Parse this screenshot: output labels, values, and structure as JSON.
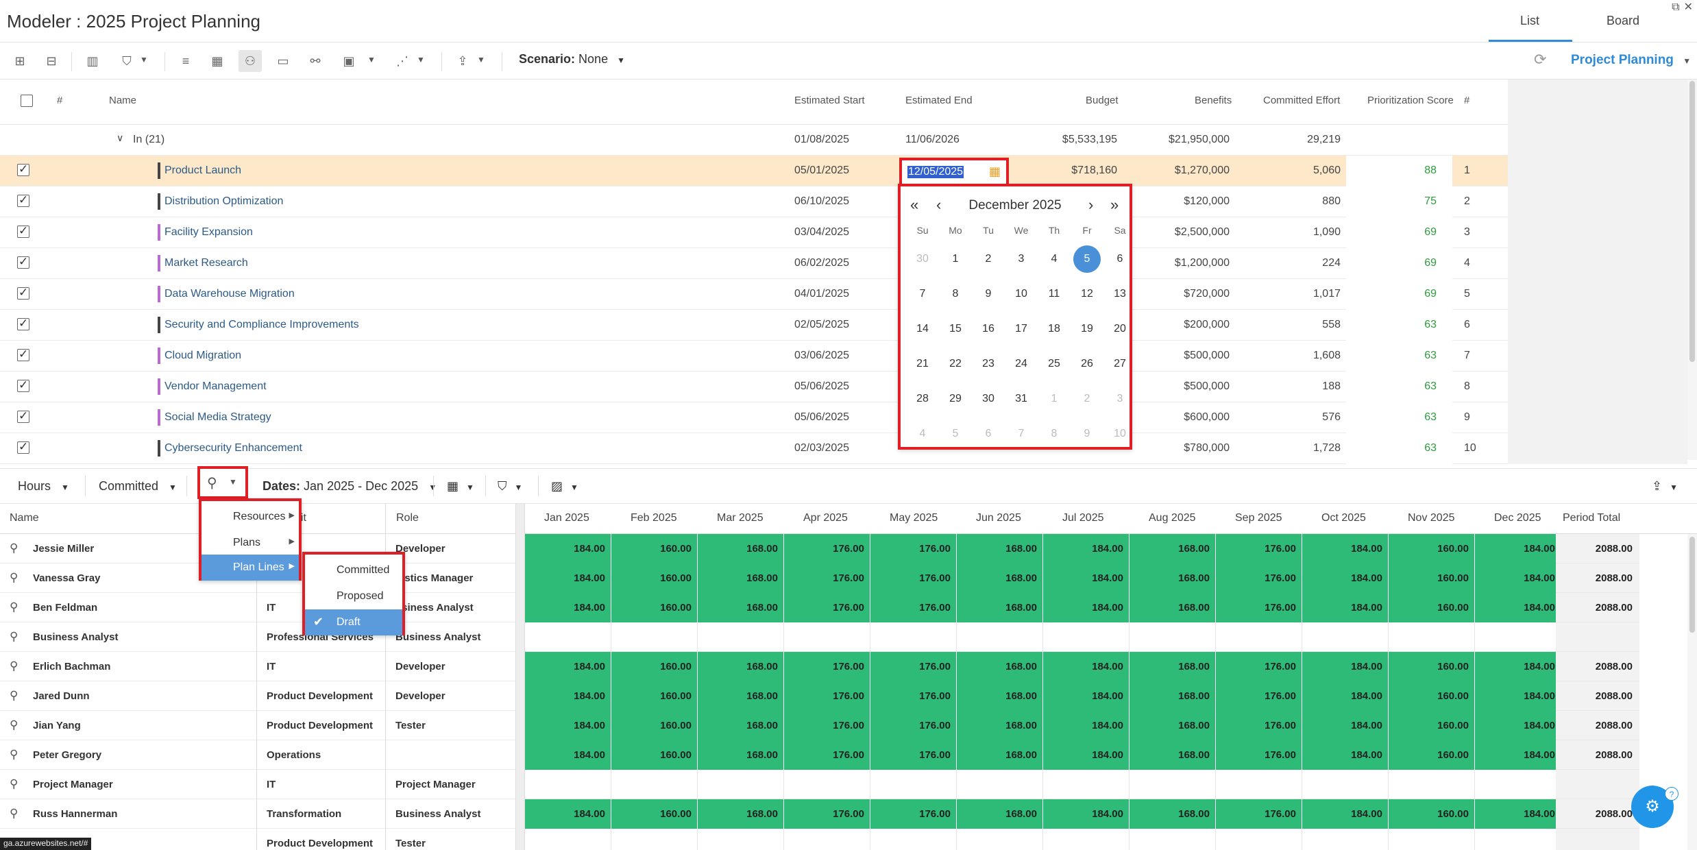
{
  "app": {
    "title": "Modeler : 2025 Project Planning",
    "tabs": [
      "List",
      "Board"
    ],
    "active_tab": "List"
  },
  "toolbar": {
    "scenario_label": "Scenario:",
    "scenario_value": "None",
    "project_selector": "Project Planning"
  },
  "grid": {
    "headers": {
      "num": "#",
      "name": "Name",
      "est_start": "Estimated Start",
      "est_end": "Estimated End",
      "budget": "Budget",
      "benefits": "Benefits",
      "effort": "Committed Effort",
      "score": "Prioritization Score",
      "rank": "#"
    },
    "group": {
      "label": "In (21)",
      "est_start": "01/08/2025",
      "est_end": "11/06/2026",
      "budget": "$5,533,195",
      "benefits": "$21,950,000",
      "effort": "29,219"
    },
    "rows": [
      {
        "name": "Product Launch",
        "est_start": "05/01/2025",
        "est_end": "12/05/2025",
        "budget": "$718,160",
        "benefits": "$1,270,000",
        "effort": "5,060",
        "score": "88",
        "rank": "1",
        "color": "#444444"
      },
      {
        "name": "Distribution Optimization",
        "est_start": "06/10/2025",
        "est_end": "",
        "budget": "",
        "benefits": "$120,000",
        "effort": "880",
        "score": "75",
        "rank": "2",
        "color": "#444444"
      },
      {
        "name": "Facility Expansion",
        "est_start": "03/04/2025",
        "est_end": "",
        "budget": "",
        "benefits": "$2,500,000",
        "effort": "1,090",
        "score": "69",
        "rank": "3",
        "color": "#b86bd0"
      },
      {
        "name": "Market Research",
        "est_start": "06/02/2025",
        "est_end": "",
        "budget": "",
        "benefits": "$1,200,000",
        "effort": "224",
        "score": "69",
        "rank": "4",
        "color": "#b86bd0"
      },
      {
        "name": "Data Warehouse Migration",
        "est_start": "04/01/2025",
        "est_end": "",
        "budget": "",
        "benefits": "$720,000",
        "effort": "1,017",
        "score": "69",
        "rank": "5",
        "color": "#b86bd0"
      },
      {
        "name": "Security and Compliance Improvements",
        "est_start": "02/05/2025",
        "est_end": "",
        "budget": "",
        "benefits": "$200,000",
        "effort": "558",
        "score": "63",
        "rank": "6",
        "color": "#444444"
      },
      {
        "name": "Cloud Migration",
        "est_start": "03/06/2025",
        "est_end": "",
        "budget": "",
        "benefits": "$500,000",
        "effort": "1,608",
        "score": "63",
        "rank": "7",
        "color": "#b86bd0"
      },
      {
        "name": "Vendor Management",
        "est_start": "05/06/2025",
        "est_end": "",
        "budget": "",
        "benefits": "$500,000",
        "effort": "188",
        "score": "63",
        "rank": "8",
        "color": "#b86bd0"
      },
      {
        "name": "Social Media Strategy",
        "est_start": "05/06/2025",
        "est_end": "",
        "budget": "",
        "benefits": "$600,000",
        "effort": "576",
        "score": "63",
        "rank": "9",
        "color": "#b86bd0"
      },
      {
        "name": "Cybersecurity Enhancement",
        "est_start": "02/03/2025",
        "est_end": "",
        "budget": "",
        "benefits": "$780,000",
        "effort": "1,728",
        "score": "63",
        "rank": "10",
        "color": "#444444"
      }
    ]
  },
  "date_editor": {
    "value": "12/05/2025"
  },
  "calendar": {
    "title": "December 2025",
    "nav": {
      "prev_year": "«",
      "prev": "‹",
      "next": "›",
      "next_year": "»"
    },
    "dow": [
      "Su",
      "Mo",
      "Tu",
      "We",
      "Th",
      "Fr",
      "Sa"
    ],
    "weeks": [
      [
        "30",
        "1",
        "2",
        "3",
        "4",
        "5",
        "6"
      ],
      [
        "7",
        "8",
        "9",
        "10",
        "11",
        "12",
        "13"
      ],
      [
        "14",
        "15",
        "16",
        "17",
        "18",
        "19",
        "20"
      ],
      [
        "21",
        "22",
        "23",
        "24",
        "25",
        "26",
        "27"
      ],
      [
        "28",
        "29",
        "30",
        "31",
        "1",
        "2",
        "3"
      ],
      [
        "4",
        "5",
        "6",
        "7",
        "8",
        "9",
        "10"
      ]
    ],
    "selected": "5"
  },
  "lower_toolbar": {
    "units": "Hours",
    "mode": "Committed",
    "dates_label": "Dates:",
    "dates_value": "Jan 2025 - Dec 2025"
  },
  "resource_grid": {
    "headers": {
      "name": "Name",
      "unit": "s Unit",
      "role": "Role",
      "months": [
        "Jan 2025",
        "Feb 2025",
        "Mar 2025",
        "Apr 2025",
        "May 2025",
        "Jun 2025",
        "Jul 2025",
        "Aug 2025",
        "Sep 2025",
        "Oct 2025",
        "Nov 2025",
        "Dec 2025"
      ],
      "total": "Period Total"
    },
    "std_values": [
      "184.00",
      "160.00",
      "168.00",
      "176.00",
      "176.00",
      "168.00",
      "184.00",
      "168.00",
      "176.00",
      "184.00",
      "160.00",
      "184.00"
    ],
    "rows": [
      {
        "name": "Jessie Miller",
        "unit": "tions",
        "role": "Developer",
        "filled": true,
        "total": "2088.00"
      },
      {
        "name": "Vanessa Gray",
        "unit": "",
        "role": "gistics Manager",
        "filled": true,
        "total": "2088.00"
      },
      {
        "name": "Ben Feldman",
        "unit": "IT",
        "role": "usiness Analyst",
        "filled": true,
        "total": "2088.00"
      },
      {
        "name": "Business Analyst",
        "unit": "Professional Services",
        "role": "Business Analyst",
        "filled": false,
        "total": ""
      },
      {
        "name": "Erlich Bachman",
        "unit": "IT",
        "role": "Developer",
        "filled": true,
        "total": "2088.00"
      },
      {
        "name": "Jared Dunn",
        "unit": "Product Development",
        "role": "Developer",
        "filled": true,
        "total": "2088.00"
      },
      {
        "name": "Jian Yang",
        "unit": "Product Development",
        "role": "Tester",
        "filled": true,
        "total": "2088.00"
      },
      {
        "name": "Peter Gregory",
        "unit": "Operations",
        "role": "",
        "filled": true,
        "total": "2088.00"
      },
      {
        "name": "Project Manager",
        "unit": "IT",
        "role": "Project Manager",
        "filled": false,
        "total": ""
      },
      {
        "name": "Russ Hannerman",
        "unit": "Transformation",
        "role": "Business Analyst",
        "filled": true,
        "total": "2088.00"
      },
      {
        "name": "",
        "unit": "Product Development",
        "role": "Tester",
        "filled": false,
        "total": ""
      }
    ]
  },
  "context_menu": {
    "items": [
      {
        "label": "Resources"
      },
      {
        "label": "Plans"
      },
      {
        "label": "Plan Lines"
      }
    ],
    "submenu": [
      {
        "label": "Committed"
      },
      {
        "label": "Proposed"
      },
      {
        "label": "Draft"
      }
    ]
  },
  "status_url": "ga.azurewebsites.net/#",
  "colors": {
    "accent": "#2f8ad8",
    "highlight_red": "#e01e26",
    "green_cell": "#2dbb77",
    "selected_row": "#fde8c9"
  }
}
